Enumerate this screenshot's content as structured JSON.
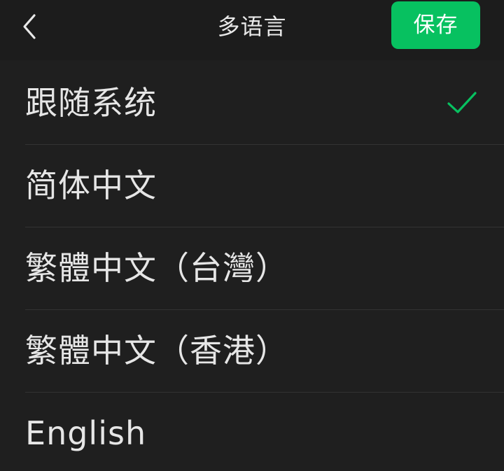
{
  "header": {
    "title": "多语言",
    "save_label": "保存",
    "back_icon": "chevron-left-icon"
  },
  "languages": [
    {
      "label": "跟随系统",
      "selected": true
    },
    {
      "label": "简体中文",
      "selected": false
    },
    {
      "label": "繁體中文（台灣）",
      "selected": false
    },
    {
      "label": "繁體中文（香港）",
      "selected": false
    },
    {
      "label": "English",
      "selected": false
    }
  ],
  "colors": {
    "accent": "#07c160",
    "background": "#1f1f1f",
    "text": "#e6e6e6"
  }
}
